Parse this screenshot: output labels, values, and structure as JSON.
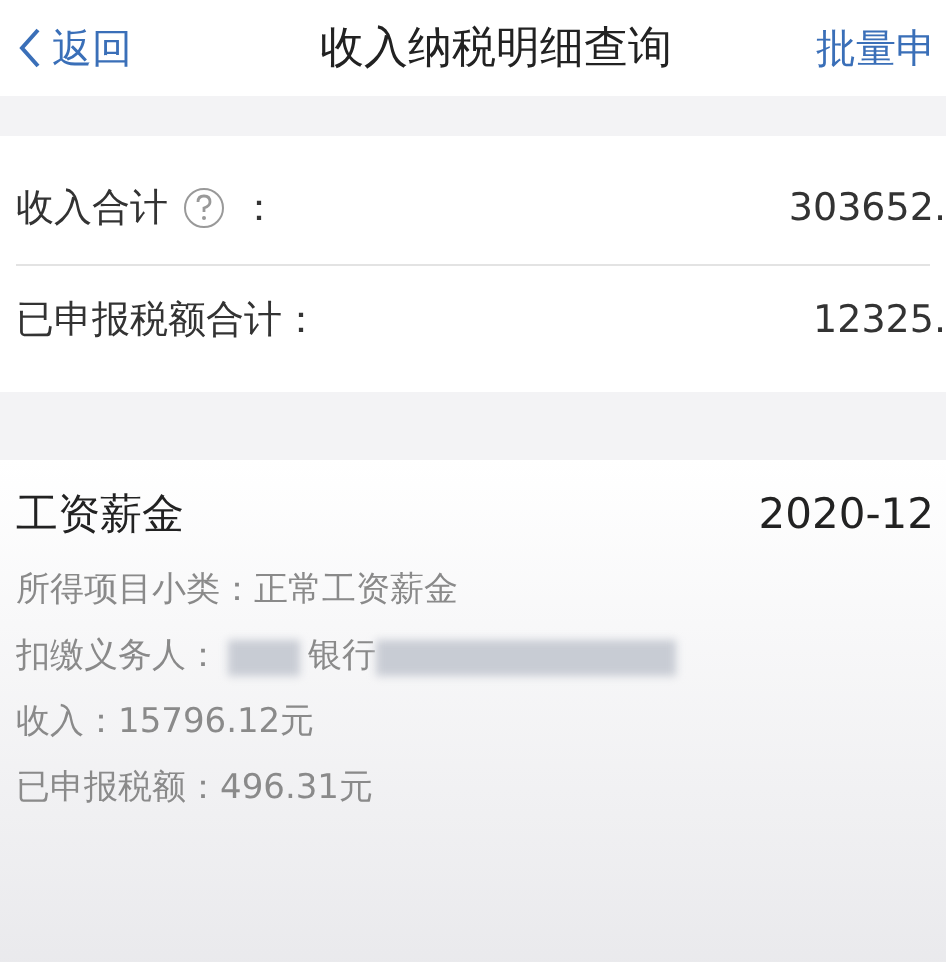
{
  "header": {
    "back": "返回",
    "title": "收入纳税明细查询",
    "action": "批量申"
  },
  "summary": [
    {
      "label": "收入合计",
      "help": true,
      "colon": "：",
      "value": "303652."
    },
    {
      "label": "已申报税额合计：",
      "help": false,
      "value": "12325."
    }
  ],
  "record": {
    "type": "工资薪金",
    "period": "2020-12",
    "details": [
      {
        "kind": "text",
        "label": "所得项目小类：",
        "value": "正常工资薪金"
      },
      {
        "kind": "redacted",
        "label": "扣缴义务人：",
        "value": "银行"
      },
      {
        "kind": "text",
        "label": "收入：",
        "value": "15796.12元"
      },
      {
        "kind": "text",
        "label": "已申报税额：",
        "value": "496.31元"
      }
    ]
  }
}
